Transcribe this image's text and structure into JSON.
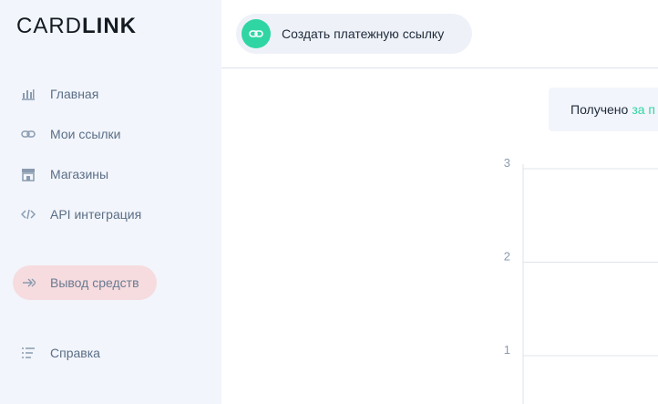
{
  "logo": {
    "part1": "CARD",
    "part2": "LINK"
  },
  "sidebar": {
    "items": [
      {
        "label": "Главная",
        "icon": "bar-chart-icon"
      },
      {
        "label": "Мои ссылки",
        "icon": "link-icon"
      },
      {
        "label": "Магазины",
        "icon": "store-icon"
      },
      {
        "label": "API интеграция",
        "icon": "code-icon"
      },
      {
        "label": "Вывод средств",
        "icon": "withdraw-arrow-icon",
        "active": true
      },
      {
        "label": "Справка",
        "icon": "list-icon"
      }
    ]
  },
  "header": {
    "create_button_label": "Создать платежную ссылку"
  },
  "summary": {
    "label": "Получено",
    "period_link": "за п"
  },
  "chart_data": {
    "type": "line",
    "ylim": [
      0,
      3
    ],
    "yticks": [
      "3",
      "2",
      "1"
    ],
    "grid": true
  },
  "colors": {
    "accent": "#2fd6a4",
    "active_bg": "#f6dcdf",
    "sidebar_bg": "#f2f5fb"
  }
}
